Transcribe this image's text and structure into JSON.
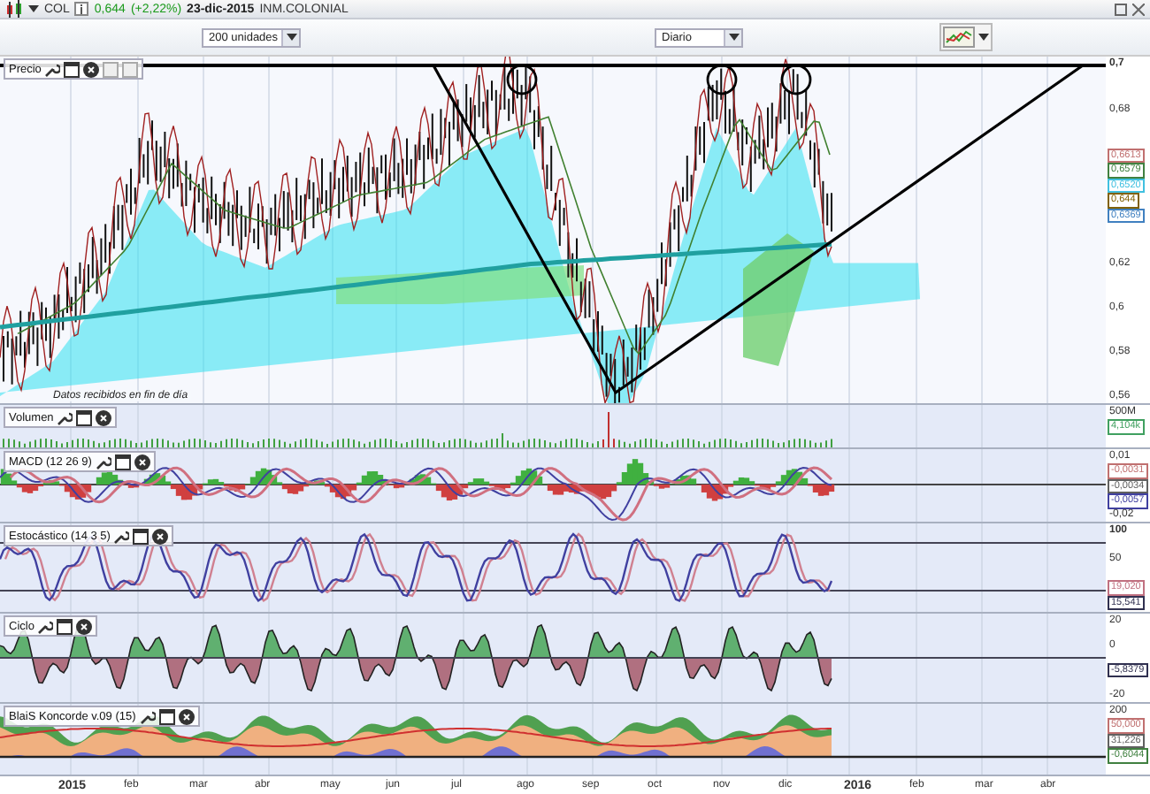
{
  "header": {
    "symbol": "COL",
    "price": "0,644",
    "change": "(+2,22%)",
    "date": "23-dic-2015",
    "name": "INM.COLONIAL"
  },
  "toolbar": {
    "range": "200 unidades",
    "interval": "Diario"
  },
  "panels": [
    {
      "kind": "price",
      "title": "Precio",
      "notice": "Datos recibidos en fin de día",
      "ticks": [
        "0,7",
        "0,68",
        "0,62",
        "0,6",
        "0,58",
        "0,56"
      ],
      "tags": [
        {
          "text": "0,6613",
          "color": "#c07070"
        },
        {
          "text": "0,6579",
          "color": "#408040"
        },
        {
          "text": "0,6520",
          "color": "#40c0e0"
        },
        {
          "text": "0,644",
          "color": "#806000"
        },
        {
          "text": "0,6369",
          "color": "#4080c0"
        }
      ]
    },
    {
      "kind": "volume",
      "title": "Volumen",
      "ticks": [
        "500M"
      ],
      "tags": [
        {
          "text": "4,104k",
          "color": "#40a060"
        }
      ]
    },
    {
      "kind": "macd",
      "title": "MACD (12 26 9)",
      "ticks": [
        "0,01",
        "-0,02"
      ],
      "tags": [
        {
          "text": "-0,0031",
          "color": "#c07070"
        },
        {
          "text": "-0,0034",
          "color": "#606060"
        },
        {
          "text": "-0,0057",
          "color": "#4040a0"
        }
      ]
    },
    {
      "kind": "stoch",
      "title": "Estocástico (14 3 5)",
      "ticks": [
        "100",
        "50"
      ],
      "tags": [
        {
          "text": "19,020",
          "color": "#c07080"
        },
        {
          "text": "15,541",
          "color": "#303050"
        }
      ]
    },
    {
      "kind": "cycle",
      "title": "Ciclo",
      "ticks": [
        "20",
        "0",
        "-20"
      ],
      "tags": [
        {
          "text": "-5,8379",
          "color": "#303050"
        }
      ]
    },
    {
      "kind": "koncorde",
      "title": "BlaiS Koncorde v.09 (15)",
      "ticks": [
        "200"
      ],
      "tags": [
        {
          "text": "50,000",
          "color": "#c07070"
        },
        {
          "text": "31,226",
          "color": "#606060"
        },
        {
          "text": "-0,6044",
          "color": "#408040"
        }
      ]
    }
  ],
  "xaxis": [
    "2015",
    "feb",
    "mar",
    "abr",
    "may",
    "jun",
    "jul",
    "ago",
    "sep",
    "oct",
    "nov",
    "dic",
    "2016",
    "feb",
    "mar",
    "abr"
  ]
}
